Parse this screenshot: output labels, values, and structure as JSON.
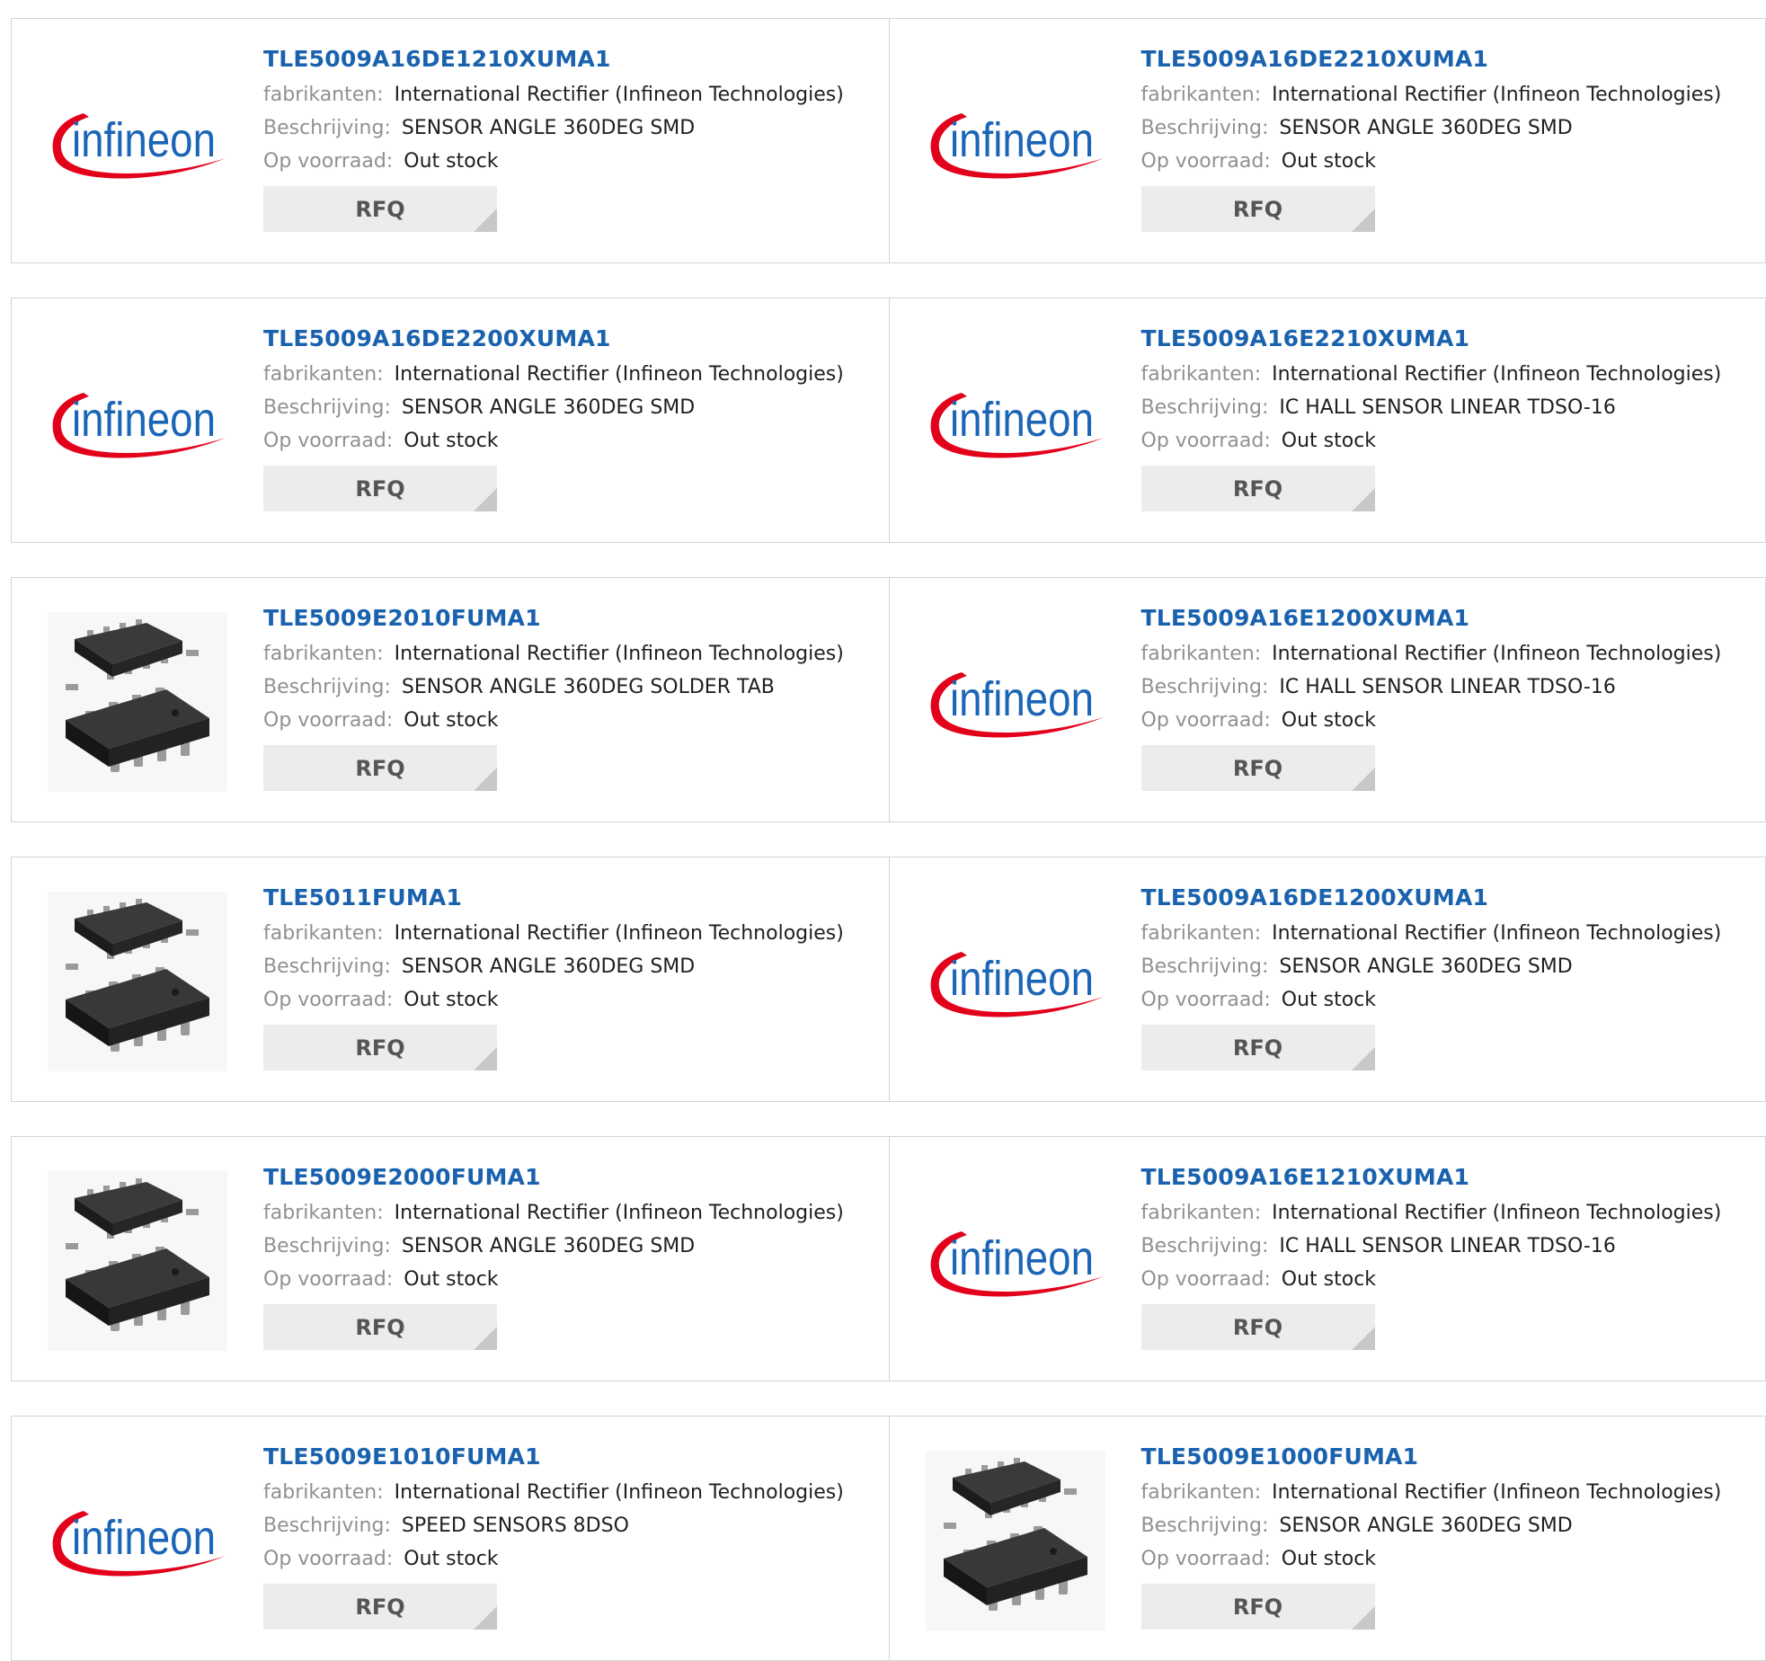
{
  "labels": {
    "manufacturer": "fabrikanten:",
    "description": "Beschrijving:",
    "stock": "Op voorraad:",
    "rfq": "RFQ"
  },
  "images": {
    "infineon_logo_text": "infineon",
    "colors": {
      "infineon_blue": "#1b65b6",
      "infineon_red": "#e2001a",
      "link_blue": "#1a62ae"
    }
  },
  "products": [
    {
      "part": "TLE5009A16DE1210XUMA1",
      "manufacturer": "International Rectifier (Infineon Technologies)",
      "description": "SENSOR ANGLE 360DEG SMD",
      "stock": "Out stock",
      "image": "infineon-logo"
    },
    {
      "part": "TLE5009A16DE2210XUMA1",
      "manufacturer": "International Rectifier (Infineon Technologies)",
      "description": "SENSOR ANGLE 360DEG SMD",
      "stock": "Out stock",
      "image": "infineon-logo"
    },
    {
      "part": "TLE5009A16DE2200XUMA1",
      "manufacturer": "International Rectifier (Infineon Technologies)",
      "description": "SENSOR ANGLE 360DEG SMD",
      "stock": "Out stock",
      "image": "infineon-logo"
    },
    {
      "part": "TLE5009A16E2210XUMA1",
      "manufacturer": "International Rectifier (Infineon Technologies)",
      "description": "IC HALL SENSOR LINEAR TDSO-16",
      "stock": "Out stock",
      "image": "infineon-logo"
    },
    {
      "part": "TLE5009E2010FUMA1",
      "manufacturer": "International Rectifier (Infineon Technologies)",
      "description": "SENSOR ANGLE 360DEG SOLDER TAB",
      "stock": "Out stock",
      "image": "chip-photo"
    },
    {
      "part": "TLE5009A16E1200XUMA1",
      "manufacturer": "International Rectifier (Infineon Technologies)",
      "description": "IC HALL SENSOR LINEAR TDSO-16",
      "stock": "Out stock",
      "image": "infineon-logo"
    },
    {
      "part": "TLE5011FUMA1",
      "manufacturer": "International Rectifier (Infineon Technologies)",
      "description": "SENSOR ANGLE 360DEG SMD",
      "stock": "Out stock",
      "image": "chip-photo"
    },
    {
      "part": "TLE5009A16DE1200XUMA1",
      "manufacturer": "International Rectifier (Infineon Technologies)",
      "description": "SENSOR ANGLE 360DEG SMD",
      "stock": "Out stock",
      "image": "infineon-logo"
    },
    {
      "part": "TLE5009E2000FUMA1",
      "manufacturer": "International Rectifier (Infineon Technologies)",
      "description": "SENSOR ANGLE 360DEG SMD",
      "stock": "Out stock",
      "image": "chip-photo"
    },
    {
      "part": "TLE5009A16E1210XUMA1",
      "manufacturer": "International Rectifier (Infineon Technologies)",
      "description": "IC HALL SENSOR LINEAR TDSO-16",
      "stock": "Out stock",
      "image": "infineon-logo"
    },
    {
      "part": "TLE5009E1010FUMA1",
      "manufacturer": "International Rectifier (Infineon Technologies)",
      "description": "SPEED SENSORS 8DSO",
      "stock": "Out stock",
      "image": "infineon-logo"
    },
    {
      "part": "TLE5009E1000FUMA1",
      "manufacturer": "International Rectifier (Infineon Technologies)",
      "description": "SENSOR ANGLE 360DEG SMD",
      "stock": "Out stock",
      "image": "chip-photo"
    }
  ]
}
